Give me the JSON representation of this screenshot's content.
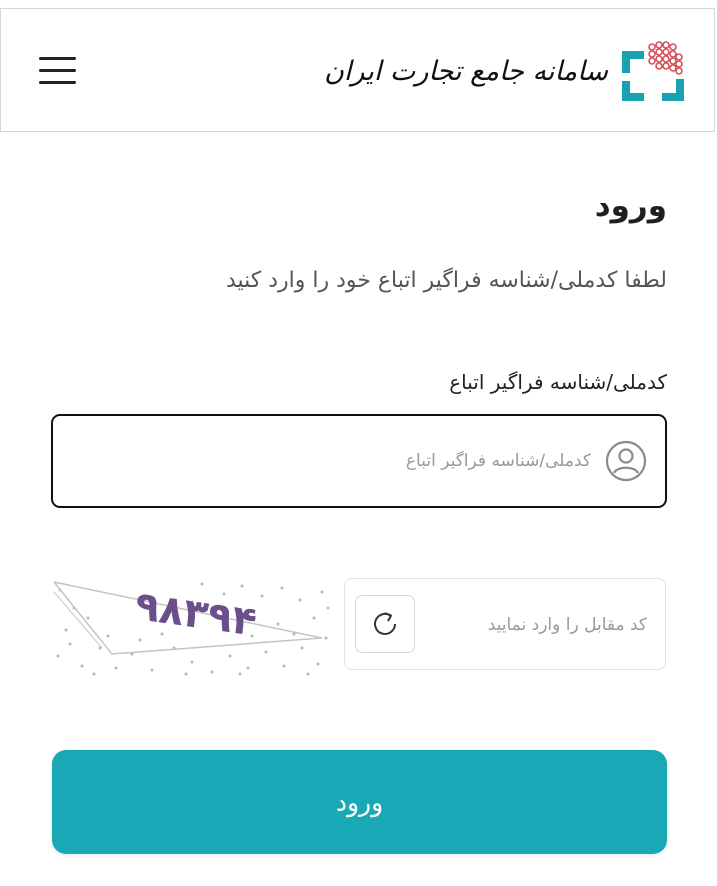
{
  "header": {
    "logo_text": "سامانه جامع تجارت ایران",
    "menu_icon": "hamburger-menu-icon",
    "logo_icon": "ntsw-logo-icon"
  },
  "login": {
    "title": "ورود",
    "subtitle": "لطفا کدملی/شناسه فراگیر اتباع خود را وارد کنید",
    "id_label": "کدملی/شناسه فراگیر اتباع",
    "id_placeholder": "کدملی/شناسه فراگیر اتباع",
    "id_value": "",
    "id_icon": "user-icon"
  },
  "captcha": {
    "image_text": "۹۸۳۹۴",
    "placeholder": "کد مقابل را وارد نمایید",
    "value": "",
    "refresh_icon": "refresh-icon"
  },
  "submit_label": "ورود",
  "colors": {
    "primary": "#19a9b6",
    "logo_teal": "#17a2b1",
    "logo_red": "#d8505a"
  }
}
